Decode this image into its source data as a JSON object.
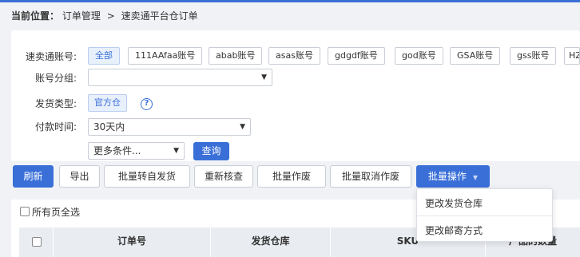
{
  "breadcrumb": {
    "current_label": "当前位置：",
    "crumb1": "订单管理",
    "sep": ">",
    "crumb2": "速卖通平台仓订单"
  },
  "filters": {
    "account_label": "速卖通账号:",
    "accounts": [
      "全部",
      "111AAfaa账号",
      "abab账号",
      "asas账号",
      "gdgdf账号",
      "god账号",
      "GSA账号",
      "gss账号",
      "HZ"
    ],
    "group_label": "账号分组:",
    "group_value": "",
    "ship_type_label": "发货类型:",
    "ship_type_value": "官方仓",
    "help_symbol": "?",
    "pay_time_label": "付款时间:",
    "pay_time_value": "30天内",
    "more_conditions": "更多条件...",
    "query_button": "查询"
  },
  "toolbar": {
    "refresh": "刷新",
    "export": "导出",
    "batch_self_ship": "批量转自发货",
    "recheck": "重新核查",
    "batch_void": "批量作废",
    "batch_unvoid": "批量取消作废",
    "batch_ops": "批量操作"
  },
  "dropdown": {
    "item1": "更改发货仓库",
    "item2": "更改邮寄方式"
  },
  "table": {
    "select_all_pages": "所有页全选",
    "headers": [
      "订单号",
      "发货仓库",
      "SKU",
      "产品的数量"
    ]
  },
  "colors": {
    "accent": "#3a6fd8"
  }
}
